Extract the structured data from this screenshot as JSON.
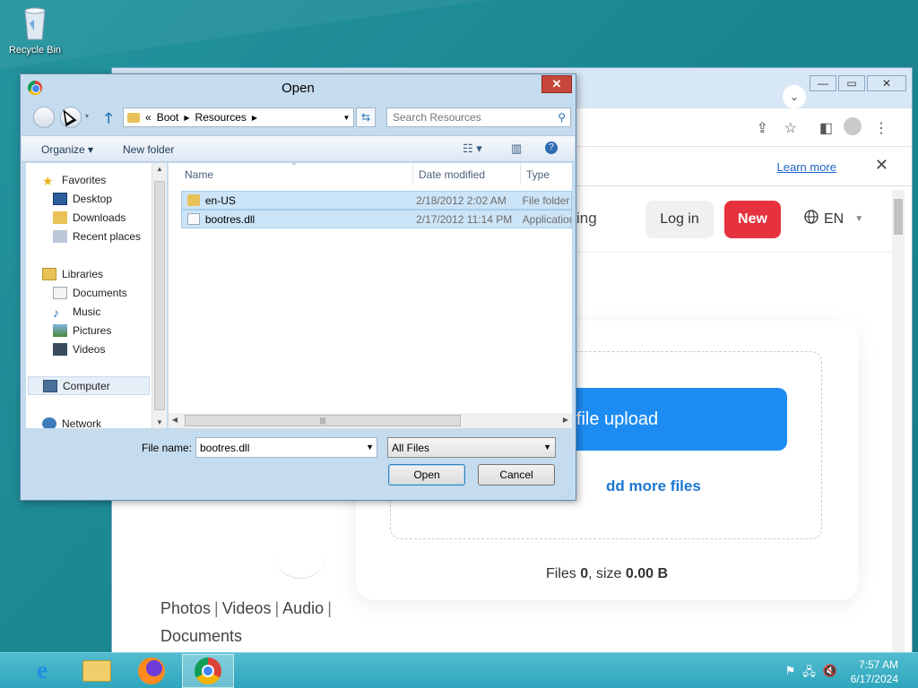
{
  "desktop": {
    "recycle_bin_label": "Recycle Bin"
  },
  "browser": {
    "learn_more": "Learn more",
    "site_partial_text": "ing",
    "login_label": "Log in",
    "new_label": "New",
    "lang_label": "EN",
    "start_upload": "art file upload",
    "add_more": "dd more files",
    "files_prefix": "Files ",
    "files_count": "0",
    "size_prefix": ", size ",
    "size_value": "0.00 B",
    "links": [
      "Photos",
      "Videos",
      "Audio",
      "Documents"
    ],
    "accent_blue": "#1d8cf2",
    "accent_red": "#e5323e"
  },
  "dialog": {
    "title": "Open",
    "address": {
      "prefix": "«",
      "crumbs": [
        "Boot",
        "Resources"
      ]
    },
    "search_placeholder": "Search Resources",
    "commands": {
      "organize": "Organize ▾",
      "new_folder": "New folder"
    },
    "nav": {
      "favorites": "Favorites",
      "desktop": "Desktop",
      "downloads": "Downloads",
      "recent": "Recent places",
      "libraries": "Libraries",
      "documents": "Documents",
      "music": "Music",
      "pictures": "Pictures",
      "videos": "Videos",
      "computer": "Computer",
      "network": "Network"
    },
    "columns": {
      "name": "Name",
      "date": "Date modified",
      "type": "Type"
    },
    "files": [
      {
        "name": "en-US",
        "date": "2/18/2012 2:02 AM",
        "type": "File folder",
        "kind": "folder"
      },
      {
        "name": "bootres.dll",
        "date": "2/17/2012 11:14 PM",
        "type": "Application extension",
        "kind": "dll"
      }
    ],
    "file_name_label": "File name:",
    "file_name_value": "bootres.dll",
    "filter_value": "All Files",
    "open_label": "Open",
    "cancel_label": "Cancel"
  },
  "taskbar": {
    "time": "7:57 AM",
    "date": "6/17/2024"
  }
}
